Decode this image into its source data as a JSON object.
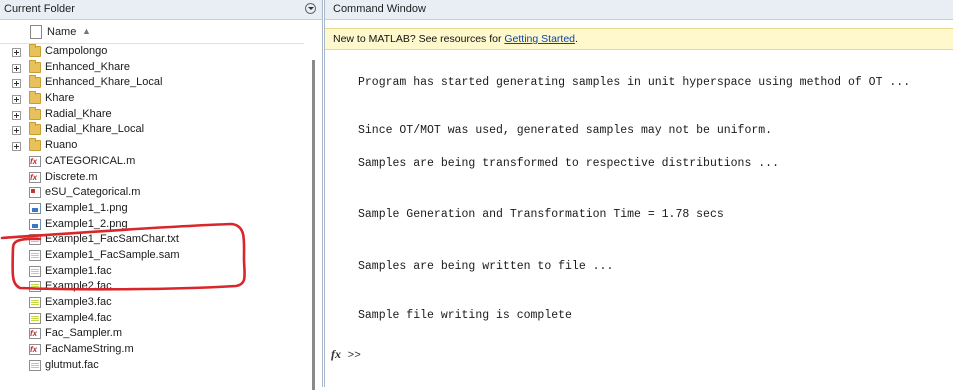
{
  "current_folder": {
    "title": "Current Folder",
    "column_name": "Name",
    "sort_indicator": "▲",
    "items": [
      {
        "label": "Campolongo",
        "type": "folder"
      },
      {
        "label": "Enhanced_Khare",
        "type": "folder"
      },
      {
        "label": "Enhanced_Khare_Local",
        "type": "folder"
      },
      {
        "label": "Khare",
        "type": "folder"
      },
      {
        "label": "Radial_Khare",
        "type": "folder"
      },
      {
        "label": "Radial_Khare_Local",
        "type": "folder"
      },
      {
        "label": "Ruano",
        "type": "folder"
      },
      {
        "label": "CATEGORICAL.m",
        "type": "m"
      },
      {
        "label": "Discrete.m",
        "type": "m"
      },
      {
        "label": "eSU_Categorical.m",
        "type": "mlx"
      },
      {
        "label": "Example1_1.png",
        "type": "png"
      },
      {
        "label": "Example1_2.png",
        "type": "png"
      },
      {
        "label": "Example1_FacSamChar.txt",
        "type": "txt"
      },
      {
        "label": "Example1_FacSample.sam",
        "type": "txt"
      },
      {
        "label": "Example1.fac",
        "type": "txt"
      },
      {
        "label": "Example2.fac",
        "type": "txt"
      },
      {
        "label": "Example3.fac",
        "type": "txt"
      },
      {
        "label": "Example4.fac",
        "type": "txt"
      },
      {
        "label": "Fac_Sampler.m",
        "type": "m"
      },
      {
        "label": "FacNameString.m",
        "type": "m"
      },
      {
        "label": "glutmut.fac",
        "type": "txt"
      }
    ]
  },
  "command_window": {
    "title": "Command Window",
    "info_text": "New to MATLAB? See resources for ",
    "info_link": "Getting Started",
    "info_suffix": ".",
    "lines": [
      "Program has started generating samples in unit hyperspace using method of OT ...",
      "Since OT/MOT was used, generated samples may not be uniform.",
      "Samples are being transformed to respective distributions ...",
      "Sample Generation and Transformation Time = 1.78 secs",
      "Samples are being written to file ...",
      "Sample file writing is complete"
    ],
    "prompt_symbol": "fx",
    "prompt": ">>"
  },
  "annotation_color": "#d9262b"
}
